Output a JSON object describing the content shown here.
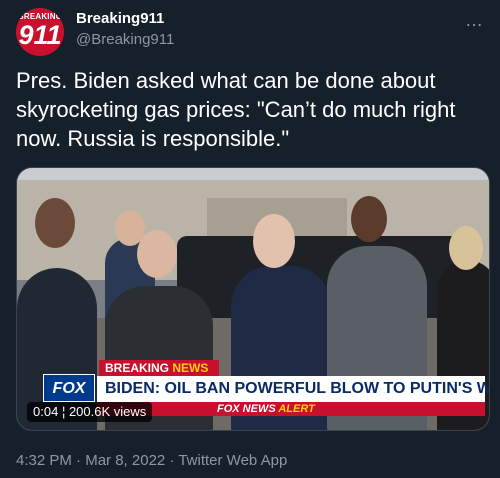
{
  "account": {
    "avatar_top": "BREAKING",
    "avatar_big": "911",
    "name": "Breaking911",
    "handle": "@Breaking911"
  },
  "more_icon": "…",
  "tweet": {
    "text": "Pres. Biden asked what can be done about skyrocketing gas prices: \"Can’t do much right now. Russia is responsible.\""
  },
  "video": {
    "breaking": "BREAKING",
    "news": "NEWS",
    "network_logo": "FOX",
    "headline": "BIDEN: OIL BAN POWERFUL BLOW TO PUTIN'S WAR",
    "alert_network": "FOX NEWS",
    "alert_word": "ALERT",
    "time": "0:04",
    "views": "200.6K views"
  },
  "meta": {
    "time": "4:32 PM",
    "separator": "·",
    "date": "Mar 8, 2022",
    "client": "Twitter Web App"
  },
  "colors": {
    "background": "#15202b",
    "secondary_text": "#8b98a5",
    "brand_red": "#c8102e"
  }
}
